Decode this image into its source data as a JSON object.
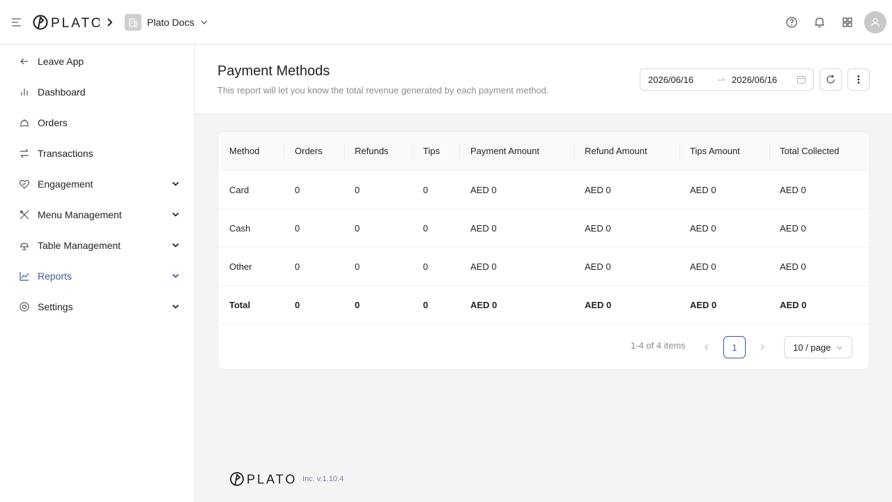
{
  "header": {
    "logo_text": "PLATO",
    "workspace_name": "Plato Docs"
  },
  "sidebar": {
    "items": [
      {
        "label": "Leave App",
        "icon": "arrow-left-icon"
      },
      {
        "label": "Dashboard",
        "icon": "bar-chart-icon"
      },
      {
        "label": "Orders",
        "icon": "cloche-icon"
      },
      {
        "label": "Transactions",
        "icon": "swap-icon"
      },
      {
        "label": "Engagement",
        "icon": "heart-handshake-icon"
      },
      {
        "label": "Menu Management",
        "icon": "utensils-icon"
      },
      {
        "label": "Table Management",
        "icon": "table-bell-icon"
      },
      {
        "label": "Reports",
        "icon": "line-chart-icon"
      },
      {
        "label": "Settings",
        "icon": "gear-icon"
      }
    ],
    "active": "Reports"
  },
  "page": {
    "title": "Payment Methods",
    "description": "This report will let you know the total revenue generated by each payment method.",
    "date_start": "2026/06/16",
    "date_end": "2026/06/16"
  },
  "table": {
    "columns": [
      "Method",
      "Orders",
      "Refunds",
      "Tips",
      "Payment Amount",
      "Refund Amount",
      "Tips Amount",
      "Total Collected"
    ],
    "rows": [
      [
        "Card",
        "0",
        "0",
        "0",
        "AED 0",
        "AED 0",
        "AED 0",
        "AED 0"
      ],
      [
        "Cash",
        "0",
        "0",
        "0",
        "AED 0",
        "AED 0",
        "AED 0",
        "AED 0"
      ],
      [
        "Other",
        "0",
        "0",
        "0",
        "AED 0",
        "AED 0",
        "AED 0",
        "AED 0"
      ],
      [
        "Total",
        "0",
        "0",
        "0",
        "AED 0",
        "AED 0",
        "AED 0",
        "AED 0"
      ]
    ]
  },
  "pagination": {
    "summary": "1-4 of 4 items",
    "current_page": "1",
    "page_size": "10 / page"
  },
  "footer": {
    "logo_text": "PLATO",
    "version": "Inc. v.1.10.4"
  },
  "colors": {
    "accent": "#3b5998",
    "border": "#e8e8e8",
    "muted_text": "#8c8c8c"
  }
}
